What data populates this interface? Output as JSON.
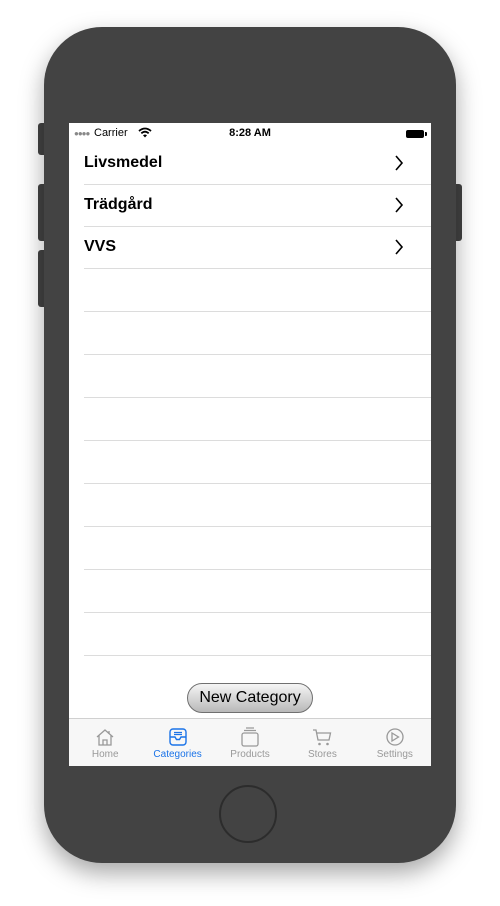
{
  "status_bar": {
    "carrier": "Carrier",
    "time": "8:28 AM"
  },
  "categories": [
    {
      "label": "Livsmedel"
    },
    {
      "label": "Trädgård"
    },
    {
      "label": "VVS"
    }
  ],
  "new_category_button": "New Category",
  "tab_bar": {
    "active": "Categories",
    "active_color": "#1a73e8",
    "inactive_color": "#999999",
    "tabs": [
      {
        "label": "Home",
        "icon": "home-icon"
      },
      {
        "label": "Categories",
        "icon": "categories-tray-icon"
      },
      {
        "label": "Products",
        "icon": "products-stack-icon"
      },
      {
        "label": "Stores",
        "icon": "cart-icon"
      },
      {
        "label": "Settings",
        "icon": "settings-gear-icon"
      }
    ]
  }
}
